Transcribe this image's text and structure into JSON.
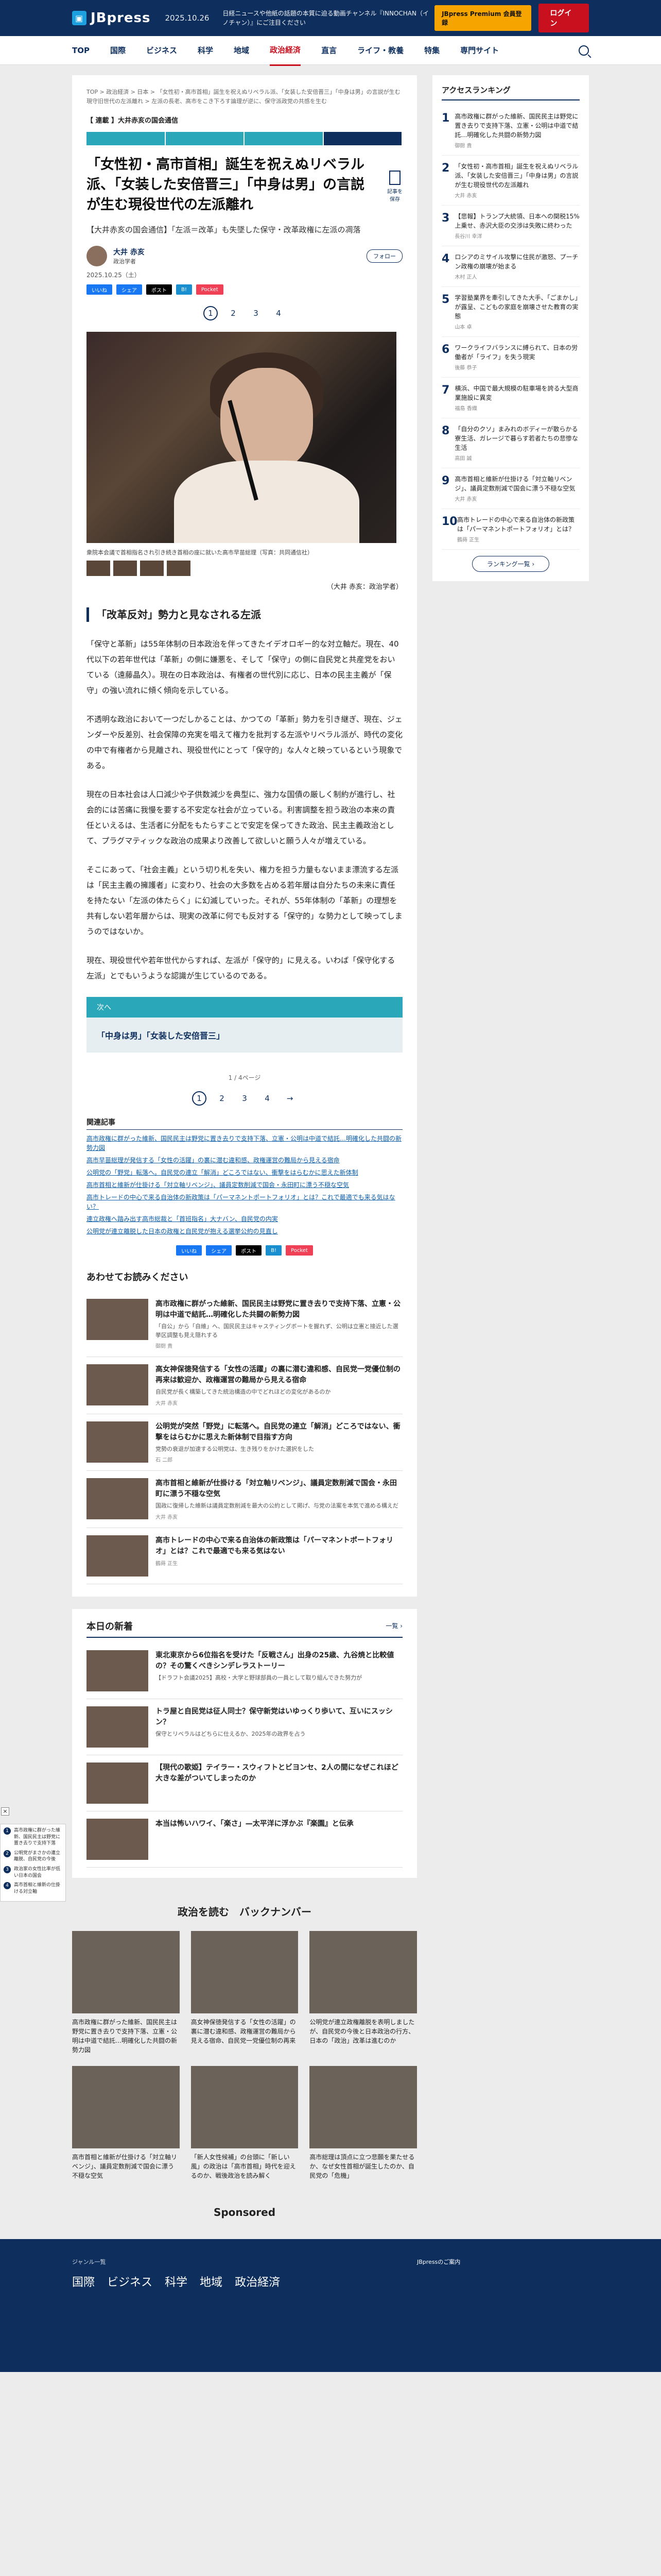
{
  "header": {
    "logo": "JBpress",
    "date": "2025.10.26",
    "news_ticker": "日経ニュースや他紙の話題の本質に迫る動画チャンネル『INNOCHAN（イノチャン）』にご注目ください",
    "premium": "JBpress Premium 会員登録",
    "login": "ログイン"
  },
  "nav": [
    "TOP",
    "国際",
    "ビジネス",
    "科学",
    "地域",
    "政治経済",
    "直言",
    "ライフ・教養",
    "特集",
    "専門サイト"
  ],
  "breadcrumb": "TOP > 政治経済 > 日本 > 「女性初・高市首相」誕生を祝えぬリベラル派、「女装した安倍晋三」「中身は男」の言説が生む現守旧世代の左派離れ > 左派の長老、高市をこき下ろす論理が逆に、保守派政党の共感を生む",
  "article": {
    "series": "【 連載 】大井赤亥の国会通信",
    "headline": "「女性初・高市首相」誕生を祝えぬリベラル派、「女装した安倍晋三」「中身は男」の言説が生む現役世代の左派離れ",
    "bookmark_label": "記事を保存",
    "subline": "【大井赤亥の国会通信】「左派＝改革」も失墜した保守・改革政権に左派の凋落",
    "author_name": "大井 赤亥",
    "author_role": "政治学者",
    "follow": "フォロー",
    "date": "2025.10.25（土）",
    "share": [
      "いいね",
      "シェア",
      "ポスト",
      "B!",
      "Pocket"
    ],
    "pages": [
      "1",
      "2",
      "3",
      "4"
    ],
    "photo_caption": "衆院本会議で首相指名され引き続き首相の座に就いた高市早苗総理（写真：共同通信社）",
    "credit": "（大井 赤亥：政治学者）",
    "h2": "「改革反対」勢力と見なされる左派",
    "paragraphs": [
      "「保守と革新」は55年体制の日本政治を伴ってきたイデオロギー的な対立軸だ。現在、40代以下の若年世代は「革新」の側に嫌悪を、そして「保守」の側に自民党と共産党をおいている（遠藤晶久）。現在の日本政治は、有権者の世代別に応じ、日本の民主主義が「保守」の強い流れに傾く傾向を示している。",
      "不透明な政治において一つだしかることは、かつての「革新」勢力を引き継ぎ、現在、ジェンダーや反差別、社会保障の充実を唱えて権力を批判する左派やリベラル派が、時代の変化の中で有権者から見離され、現役世代にとって「保守的」な人々と映っているという現象である。",
      "現在の日本社会は人口減少や子供数減少を典型に、強力な国債の厳しく制約が進行し、社会的には苦痛に我慢を要する不安定な社会が立っている。利害調整を担う政治の本来の責任といえるは、生活者に分配をもたらすことで安定を保ってきた政治、民主主義政治として、プラグマティックな政治の成果より改善して欲しいと願う人々が増えている。",
      "そこにあって、「社会主義」という切り札を失い、権力を担う力量もないまま漂流する左派は「民主主義の擁護者」に変わり、社会の大多数を占める若年層は自分たちの未来に責任を持たない「左派の体たらく」に幻滅していった。それが、55年体制の「革新」の理想を共有しない若年層からは、現実の改革に何でも反対する「保守的」な勢力として映ってしまうのではないか。",
      "現在、現役世代や若年世代からすれば、左派が「保守的」に見える。いわば「保守化する左派」とでもいうような認識が生じているのである。"
    ],
    "next_label": "次へ",
    "next_title": "「中身は男」「女装した安倍晋三」",
    "page_count": "1 / 4ページ",
    "related_title": "関連記事",
    "related": [
      "高市政権に群がった維新、国民民主は野党に置き去りで支持下落、立憲・公明は中道で結託…明確化した共闘の新勢力図",
      "高市早苗総理が発信する「女性の活躍」の裏に潜む違和感、政権運営の難局から見える宿命",
      "公明党の「野党」転落へ。自民党の連立「解消」どころではない、衝撃をはらむかに思えた新体制",
      "高市首相と維新が仕掛ける「対立軸リベンジ」、議員定数削減で国会・永田町に漂う不穏な空気",
      "高市トレードの中心で来る自治体の新政策は「パーマネントポートフォリオ」とは？これで最適でも来る気はない？",
      "連立政権へ踏み出す高市総裁と「首班指名」大ナバン、自民党の内実",
      "公明党が連立離脱した日本の政権と自民党が抱える選挙公約の見直し"
    ]
  },
  "recommend": {
    "title": "あわせてお読みください",
    "items": [
      {
        "title": "高市政権に群がった維新、国民民主は野党に置き去りで支持下落、立憲・公明は中道で結託…明確化した共闘の新勢力図",
        "desc": "「自公」から「自維」へ、国民民主はキャスティングボートを握れず、公明は立憲と接近した選挙区調整も見え隠れする",
        "author": "御厨 貴"
      },
      {
        "title": "高女神保徳発信する「女性の活躍」の裏に潜む違和感、自民党一党優位制の再来は歓迎か、政権運営の難局から見える宿命",
        "desc": "自民党が長く構築してきた統治構造の中でどれほどの変化があるのか",
        "author": "大井 赤亥"
      },
      {
        "title": "公明党が突然「野党」に転落へ。自民党の連立「解消」どころではない、衝撃をはらむかに思えた新体制で目指す方向",
        "desc": "党勢の衰退が加速する公明党は、生き残りをかけた選択をした",
        "author": "石 二郎"
      },
      {
        "title": "高市首相と維新が仕掛ける「対立軸リベンジ」、議員定数削減で国会・永田町に漂う不穏な空気",
        "desc": "国政に復帰した維新は議員定数削減を最大の公約として掲げ、与党の法案を本気で進める構えだ",
        "author": "大井 赤亥"
      },
      {
        "title": "高市トレードの中心で来る自治体の新政策は「パーマネントポートフォリオ」とは？これで最適でも来る気はない",
        "desc": "",
        "author": "鶴蒔 正生"
      }
    ]
  },
  "float_menu": [
    {
      "n": "1",
      "t": "高市政権に群がった維新、国民民主は野党に置き去りで支持下落"
    },
    {
      "n": "2",
      "t": "公明党がまさかの連立離脱、自民党の今後"
    },
    {
      "n": "3",
      "t": "政治家の女性比率が低い日本の国会"
    },
    {
      "n": "4",
      "t": "高市首相と維新の仕掛ける対立軸"
    }
  ],
  "close_label": "×",
  "new_news": {
    "title": "本日の新着",
    "more": "一覧 ›",
    "items": [
      {
        "title": "東北東京から6位指名を受けた「反戦さん」出身の25歳、九谷焼と比較値の？その驚くべきシンデレラストーリー",
        "desc": "【ドラフト会議2025】高校・大学と野球部員の一員として取り組んできた努力が",
        "author": ""
      },
      {
        "title": "トラ屋と自民党は征人同士？保守新党はいゆっくり歩いて、互いにスッシン？",
        "desc": "保守とリベラルはどちらに仕えるか、2025年の政界を占う",
        "author": ""
      },
      {
        "title": "【現代の歌姫】テイラー・スウィフトとビヨンセ、2人の間になぜこれほど大きな差がついてしまったのか",
        "desc": "",
        "author": ""
      },
      {
        "title": "本当は怖いハワイ、「楽さ」—太平洋に浮かぶ『楽園』と伝承",
        "desc": "",
        "author": ""
      }
    ]
  },
  "politics": {
    "title": "政治を読む　バックナンバー",
    "items": [
      "高市政権に群がった維新、国民民主は野党に置き去りで支持下落、立憲・公明は中道で結託…明確化した共闘の新勢力図",
      "高女神保徳発信する「女性の活躍」の裏に潜む違和感、政権運営の難局から見える宿命、自民党一党優位制の再来",
      "公明党が連立政権離脱を表明しましたが、自民党の今後と日本政治の行方、日本の「政治」改革は進むのか",
      "高市首相と維新が仕掛ける「対立軸リベンジ」、議員定数削減で国会に漂う不穏な空気",
      "「新人女性候補」の台頭に「新しい風」の政治は「高市首相」時代を迎えるのか、戦後政治を読み解く",
      "高市総理は頂点に立つ悲願を果たせるか、なぜ女性首相が誕生したのか、自民党の「危機」"
    ]
  },
  "sponsored": "Sponsored",
  "sidebar": {
    "title": "アクセスランキング",
    "items": [
      {
        "n": "1",
        "t": "高市政権に群がった維新、国民民主は野党に置き去りで支持下落、立憲・公明は中道で結託…明確化した共闘の新勢力図",
        "a": "御厨 貴"
      },
      {
        "n": "2",
        "t": "「女性初・高市首相」誕生を祝えぬリベラル派、「女装した安倍晋三」「中身は男」の言説が生む現役世代の左派離れ",
        "a": "大井 赤亥"
      },
      {
        "n": "3",
        "t": "【悲報】トランプ大統領、日本への関税15%上乗せ、赤沢大臣の交渉は失敗に終わった",
        "a": "長谷川 幸洋"
      },
      {
        "n": "4",
        "t": "ロシアのミサイル攻撃に住民が激怒、プーチン政権の崩壊が始まる",
        "a": "木村 正人"
      },
      {
        "n": "5",
        "t": "学習塾業界を牽引してきた大手、「ごまかし」が露呈、こどもの家庭を崩壊させた教育の実態",
        "a": "山本 卓"
      },
      {
        "n": "6",
        "t": "ワークライフバランスに縛られて、日本の労働者が「ライフ」を失う現実",
        "a": "後藤 恭子"
      },
      {
        "n": "7",
        "t": "横浜、中国で最大規模の駐車場を誇る大型商業施設に異変",
        "a": "福島 香織"
      },
      {
        "n": "8",
        "t": "「自分のクソ」まみれのボディーが散らかる寮生活、ガレージで暮らす若者たちの悲惨な生活",
        "a": "高田 誠"
      },
      {
        "n": "9",
        "t": "高市首相と維新が仕掛ける「対立軸リベンジ」、議員定数削減で国会に漂う不穏な空気",
        "a": "大井 赤亥"
      },
      {
        "n": "10",
        "t": "高市トレードの中心で来る自治体の新政策は「パーマネントポートフォリオ」とは？",
        "a": "鶴蒔 正生"
      }
    ],
    "more": "ランキング一覧 ›"
  },
  "footer": {
    "label": "ジャンル一覧",
    "cats": [
      "国際",
      "ビジネス",
      "科学",
      "地域",
      "政治経済"
    ],
    "right": "JBpressのご案内"
  }
}
